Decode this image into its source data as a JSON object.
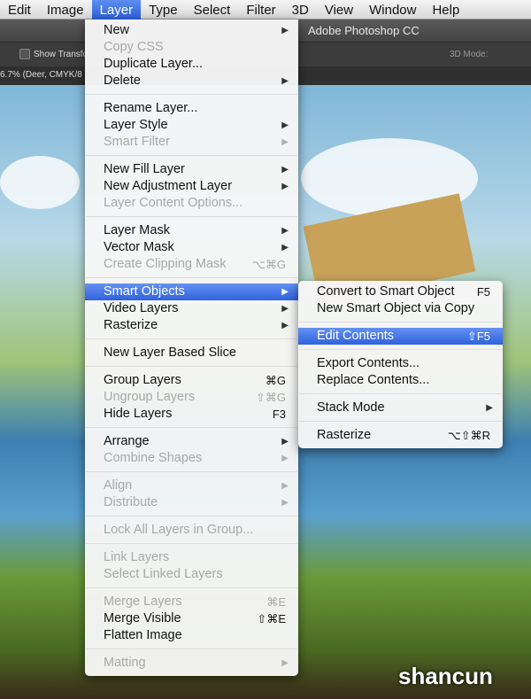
{
  "menubar": [
    {
      "label": "Edit"
    },
    {
      "label": "Image"
    },
    {
      "label": "Layer",
      "active": true
    },
    {
      "label": "Type"
    },
    {
      "label": "Select"
    },
    {
      "label": "Filter"
    },
    {
      "label": "3D"
    },
    {
      "label": "View"
    },
    {
      "label": "Window"
    },
    {
      "label": "Help"
    }
  ],
  "app_title": "Adobe Photoshop CC",
  "options": {
    "show_transform": "Show Transfo",
    "mode_3d": "3D Mode:"
  },
  "doc_tab": "6.7% (Deer, CMYK/8",
  "layer_menu": [
    [
      {
        "label": "New",
        "sub": true
      },
      {
        "label": "Copy CSS",
        "disabled": true
      },
      {
        "label": "Duplicate Layer..."
      },
      {
        "label": "Delete",
        "sub": true
      }
    ],
    [
      {
        "label": "Rename Layer..."
      },
      {
        "label": "Layer Style",
        "sub": true
      },
      {
        "label": "Smart Filter",
        "sub": true,
        "disabled": true
      }
    ],
    [
      {
        "label": "New Fill Layer",
        "sub": true
      },
      {
        "label": "New Adjustment Layer",
        "sub": true
      },
      {
        "label": "Layer Content Options...",
        "disabled": true
      }
    ],
    [
      {
        "label": "Layer Mask",
        "sub": true
      },
      {
        "label": "Vector Mask",
        "sub": true
      },
      {
        "label": "Create Clipping Mask",
        "shortcut": "⌥⌘G",
        "disabled": true
      }
    ],
    [
      {
        "label": "Smart Objects",
        "sub": true,
        "highlighted": true
      },
      {
        "label": "Video Layers",
        "sub": true
      },
      {
        "label": "Rasterize",
        "sub": true
      }
    ],
    [
      {
        "label": "New Layer Based Slice"
      }
    ],
    [
      {
        "label": "Group Layers",
        "shortcut": "⌘G"
      },
      {
        "label": "Ungroup Layers",
        "shortcut": "⇧⌘G",
        "disabled": true
      },
      {
        "label": "Hide Layers",
        "shortcut": "F3"
      }
    ],
    [
      {
        "label": "Arrange",
        "sub": true
      },
      {
        "label": "Combine Shapes",
        "sub": true,
        "disabled": true
      }
    ],
    [
      {
        "label": "Align",
        "sub": true,
        "disabled": true
      },
      {
        "label": "Distribute",
        "sub": true,
        "disabled": true
      }
    ],
    [
      {
        "label": "Lock All Layers in Group...",
        "disabled": true
      }
    ],
    [
      {
        "label": "Link Layers",
        "disabled": true
      },
      {
        "label": "Select Linked Layers",
        "disabled": true
      }
    ],
    [
      {
        "label": "Merge Layers",
        "shortcut": "⌘E",
        "disabled": true
      },
      {
        "label": "Merge Visible",
        "shortcut": "⇧⌘E"
      },
      {
        "label": "Flatten Image"
      }
    ],
    [
      {
        "label": "Matting",
        "sub": true,
        "disabled": true
      }
    ]
  ],
  "smart_objects_menu": [
    [
      {
        "label": "Convert to Smart Object",
        "shortcut": "F5"
      },
      {
        "label": "New Smart Object via Copy"
      }
    ],
    [
      {
        "label": "Edit Contents",
        "shortcut": "⇧F5",
        "highlighted": true
      }
    ],
    [
      {
        "label": "Export Contents..."
      },
      {
        "label": "Replace Contents..."
      }
    ],
    [
      {
        "label": "Stack Mode",
        "sub": true
      }
    ],
    [
      {
        "label": "Rasterize",
        "shortcut": "⌥⇧⌘R"
      }
    ]
  ],
  "watermark": "shancun"
}
